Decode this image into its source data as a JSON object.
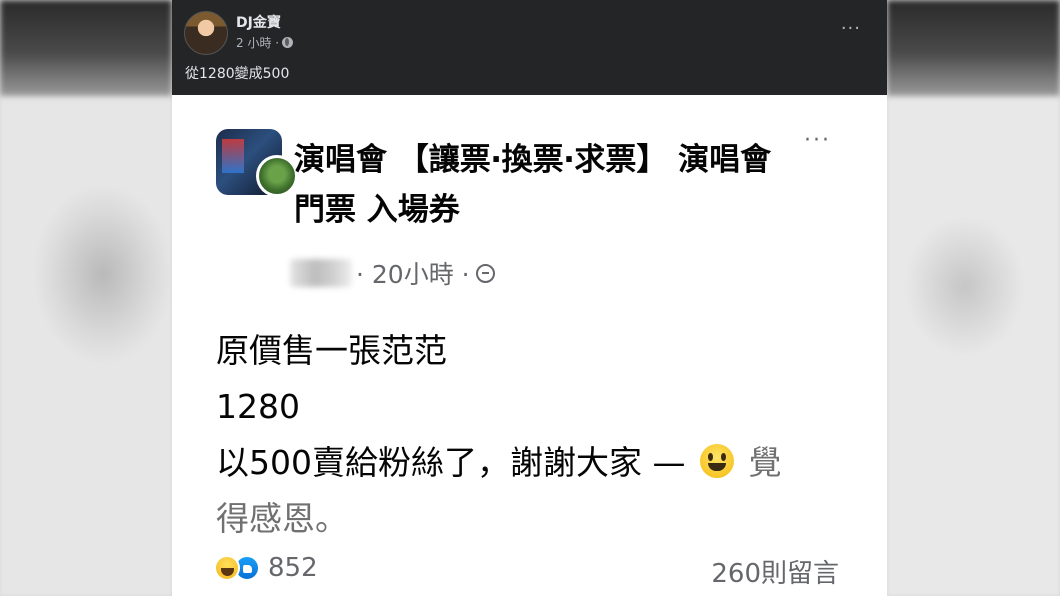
{
  "header": {
    "author": "DJ金寶",
    "time": "2 小時 ·",
    "caption": "從1280變成500",
    "more": "···"
  },
  "shared_post": {
    "group_name": "演唱會 【讓票‧換票‧求票】 演唱會 門票 入場券",
    "time": "· 20小時 ·",
    "more": "···",
    "body": {
      "line1": "原價售一張范范",
      "line2": "1280",
      "line3_prefix": "以500賣給粉絲了，謝謝大家 —",
      "line3_suffix": "覺",
      "line4": "得感恩。"
    },
    "reactions": {
      "icons": [
        "haha-icon",
        "like-icon"
      ],
      "count": "852"
    },
    "comments": "260則留言"
  }
}
